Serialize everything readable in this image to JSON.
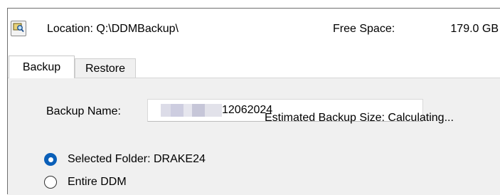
{
  "toolbar": {
    "browse_icon": "folder-search-icon",
    "location_label": "Location: Q:\\DDMBackup\\",
    "free_space_label": "Free Space:",
    "free_space_value": "179.0 GB"
  },
  "tabs": [
    {
      "label": "Backup",
      "selected": true
    },
    {
      "label": "Restore",
      "selected": false
    }
  ],
  "backup": {
    "name_label": "Backup Name:",
    "name_value": "12062024",
    "options": [
      {
        "label": "Selected Folder: DRAKE24",
        "selected": true
      },
      {
        "label": "Entire DDM",
        "selected": false
      }
    ],
    "estimated_size_label": "Estimated Backup Size: Calculating..."
  },
  "colors": {
    "accent": "#0a5fb8",
    "panel_bg": "#f0f0f0"
  }
}
